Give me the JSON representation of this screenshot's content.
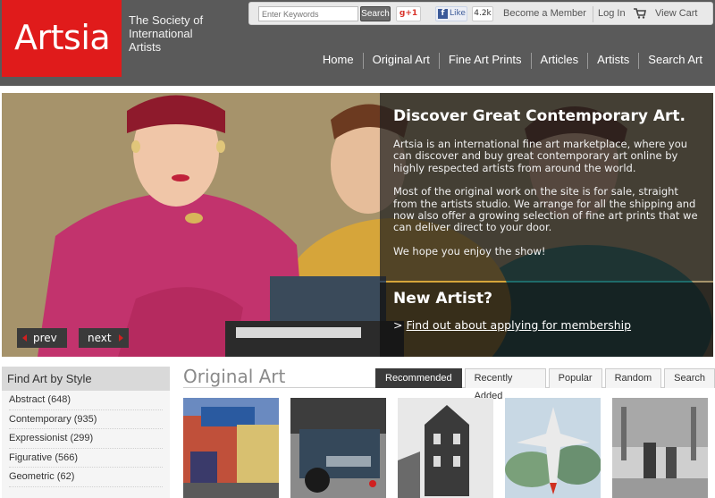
{
  "header": {
    "logo": "Artsia",
    "tagline": "The Society of International Artists",
    "search": {
      "placeholder": "Enter Keywords",
      "button": "Search"
    },
    "gplus": "+1",
    "fb_like": "Like",
    "fb_count": "4.2k",
    "links": {
      "member": "Become a Member",
      "login": "Log In",
      "cart": "View Cart"
    },
    "nav": [
      "Home",
      "Original Art",
      "Fine Art Prints",
      "Articles",
      "Artists",
      "Search Art"
    ]
  },
  "hero": {
    "title": "Discover Great Contemporary Art.",
    "paragraphs": [
      "Artsia is an international fine art marketplace, where you can discover and buy great contemporary art online by highly respected artists from around the world.",
      "Most of the original work on the site is for sale, straight from the artists studio. We arrange for all the shipping and now also offer a growing selection of fine art prints that we can deliver direct to your door.",
      "We hope you enjoy the show!"
    ],
    "new_artist": "New Artist?",
    "apply_prefix": ">",
    "apply_link": "Find out about applying for membership",
    "prev": "prev",
    "next": "next"
  },
  "sidebar": {
    "title": "Find Art by Style",
    "styles": [
      "Abstract (648)",
      "Contemporary (935)",
      "Expressionist (299)",
      "Figurative (566)",
      "Geometric (62)"
    ]
  },
  "main": {
    "title": "Original Art",
    "tabs": [
      "Recommended",
      "Recently Added",
      "Popular",
      "Random",
      "Search"
    ],
    "active_tab": "Recommended"
  },
  "colors": {
    "brand": "#e01b1b",
    "header_bg": "#5a5a5a",
    "tab_active": "#3a3a3a"
  }
}
